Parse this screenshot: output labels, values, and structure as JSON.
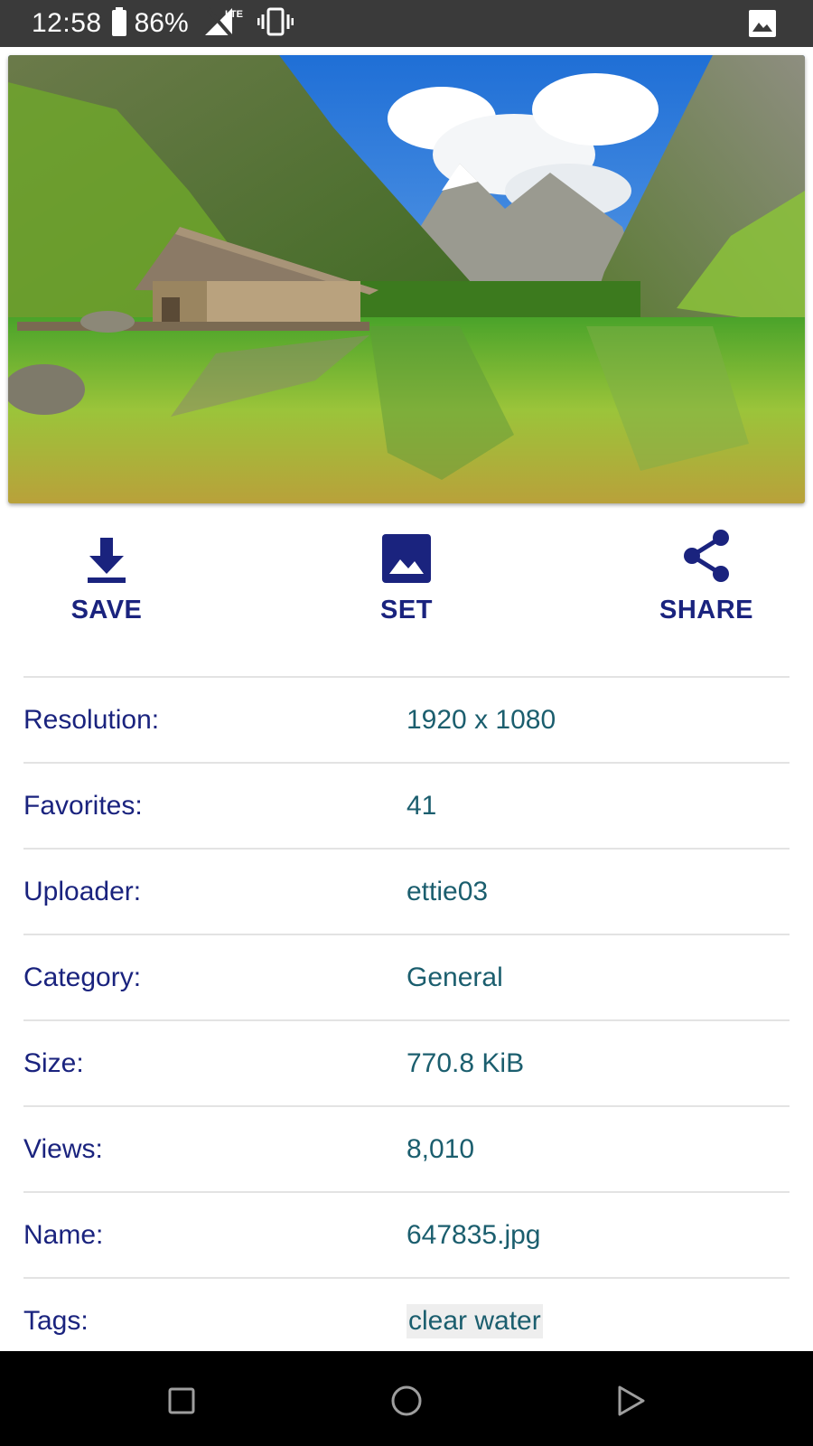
{
  "status_bar": {
    "time": "12:58",
    "battery": "86%",
    "icons": [
      "battery-icon",
      "signal-lte-icon",
      "vibrate-icon",
      "image-notification-icon"
    ]
  },
  "actions": [
    {
      "label": "SAVE",
      "icon": "download-icon"
    },
    {
      "label": "SET",
      "icon": "image-icon"
    },
    {
      "label": "SHARE",
      "icon": "share-icon"
    }
  ],
  "details": [
    {
      "key": "Resolution:",
      "value": "1920 x 1080"
    },
    {
      "key": "Favorites:",
      "value": "41"
    },
    {
      "key": "Uploader:",
      "value": "ettie03"
    },
    {
      "key": "Category:",
      "value": "General"
    },
    {
      "key": "Size:",
      "value": "770.8 KiB"
    },
    {
      "key": "Views:",
      "value": "8,010"
    },
    {
      "key": "Name:",
      "value": "647835.jpg"
    },
    {
      "key": "Tags:",
      "value": "clear water"
    }
  ],
  "nav_bar": {
    "icons": [
      "recents-square-icon",
      "home-circle-icon",
      "back-triangle-icon"
    ]
  },
  "colors": {
    "accent": "#1a237e",
    "value_text": "#1b5e6e",
    "status_bar": "#3a3a3a",
    "nav_bar": "#000000"
  }
}
